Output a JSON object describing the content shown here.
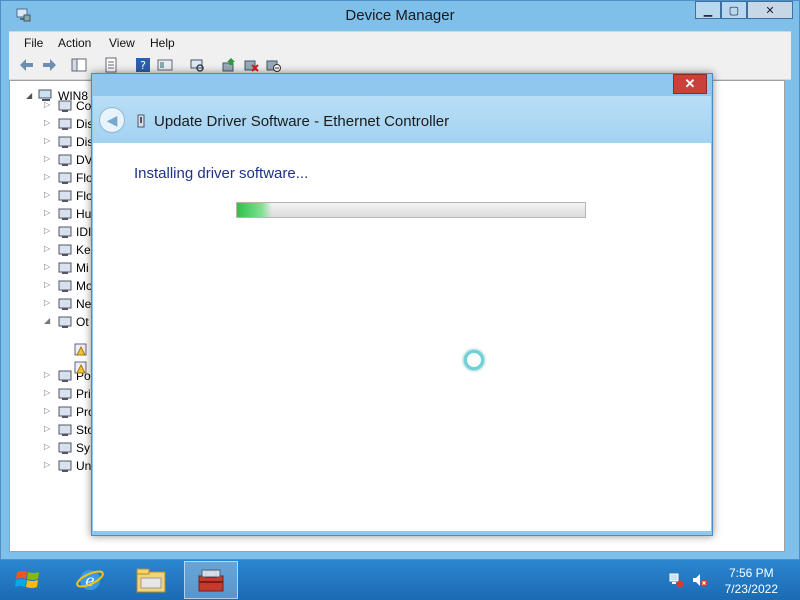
{
  "device_manager": {
    "title": "Device Manager",
    "menu": [
      "File",
      "Action",
      "View",
      "Help"
    ],
    "tree": {
      "root_label": "WIN8",
      "items": [
        {
          "label": "Co",
          "icon": "computer-icon"
        },
        {
          "label": "Dis",
          "icon": "disk-drive-icon"
        },
        {
          "label": "Dis",
          "icon": "display-adapter-icon"
        },
        {
          "label": "DV",
          "icon": "dvd-drive-icon"
        },
        {
          "label": "Flo",
          "icon": "floppy-icon"
        },
        {
          "label": "Flo",
          "icon": "floppy-controller-icon"
        },
        {
          "label": "Hu",
          "icon": "hid-icon"
        },
        {
          "label": "IDI",
          "icon": "ide-controller-icon"
        },
        {
          "label": "Ke",
          "icon": "keyboard-icon"
        },
        {
          "label": "Mi",
          "icon": "mouse-icon"
        },
        {
          "label": "Mo",
          "icon": "monitor-icon"
        },
        {
          "label": "Ne",
          "icon": "network-adapter-icon"
        },
        {
          "label": "Ot",
          "icon": "other-devices-icon"
        },
        {
          "label": "Po",
          "icon": "port-icon"
        },
        {
          "label": "Pri",
          "icon": "printer-icon"
        },
        {
          "label": "Pro",
          "icon": "processor-icon"
        },
        {
          "label": "Sto",
          "icon": "storage-controller-icon"
        },
        {
          "label": "Sy",
          "icon": "system-device-icon"
        },
        {
          "label": "Un",
          "icon": "usb-controller-icon"
        }
      ]
    }
  },
  "dialog": {
    "title": "Update Driver Software - Ethernet Controller",
    "close_label": "✕",
    "status": "Installing driver software...",
    "progress": 0.1
  },
  "taskbar": {
    "time": "7:56 PM",
    "date": "7/23/2022"
  },
  "colors": {
    "accent": "#1d6fb7",
    "window_frame": "#7fc0ea",
    "close_red": "#c9413a",
    "status_text": "#1e3287",
    "progress_green": "#2ec14a"
  }
}
